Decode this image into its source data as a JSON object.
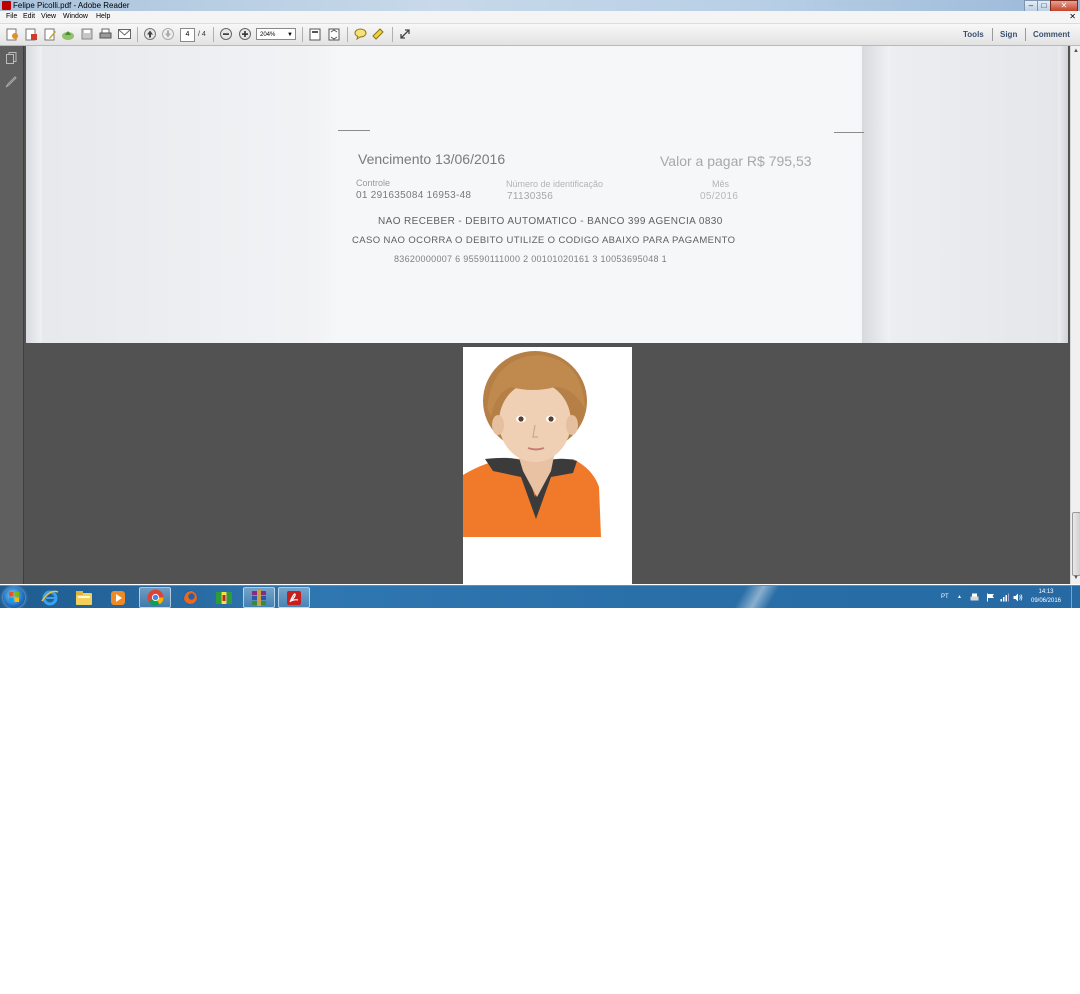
{
  "window": {
    "title": "Felipe Picolli.pdf - Adobe Reader",
    "controls": {
      "minimize": "–",
      "maximize": "□",
      "close": "✕"
    }
  },
  "menu": {
    "items": [
      "File",
      "Edit",
      "View",
      "Window",
      "Help"
    ],
    "doc_close": "✕"
  },
  "toolbar": {
    "current_page": "4",
    "page_total": "/ 4",
    "zoom": "204%",
    "links": {
      "tools": "Tools",
      "sign": "Sign",
      "comment": "Comment"
    }
  },
  "document": {
    "page1_lines": {
      "vencimento": "Vencimento  13/06/2016",
      "valor": "Valor a pagar  R$ 795,53",
      "controle_label": "Controle",
      "identificacao_label": "Número de identificação",
      "mes_label": "Mês",
      "controle_value": "01 291635084 16953-48",
      "identificacao_value": "71130356",
      "mes_value": "05/2016",
      "aviso1": "NAO RECEBER - DEBITO AUTOMATICO - BANCO  399  AGENCIA  0830",
      "aviso2": "CASO NAO OCORRA O DEBITO  UTILIZE O CODIGO ABAIXO PARA PAGAMENTO",
      "codigo": "83620000007 6  95590111000 2  00101020161 3  10053695048 1"
    }
  },
  "taskbar": {
    "apps": [
      "start",
      "internet-explorer",
      "file-explorer",
      "media-player",
      "chrome",
      "firefox",
      "app-green-yellow",
      "winrar",
      "adobe-reader"
    ],
    "tray": {
      "language": "PT",
      "show_hidden": "▲"
    },
    "clock": {
      "time": "14:13",
      "date": "09/06/2016"
    }
  },
  "colors": {
    "accent": "#2f77b1",
    "document_bg": "#525252",
    "toolbar_link": "#3a4f70"
  }
}
